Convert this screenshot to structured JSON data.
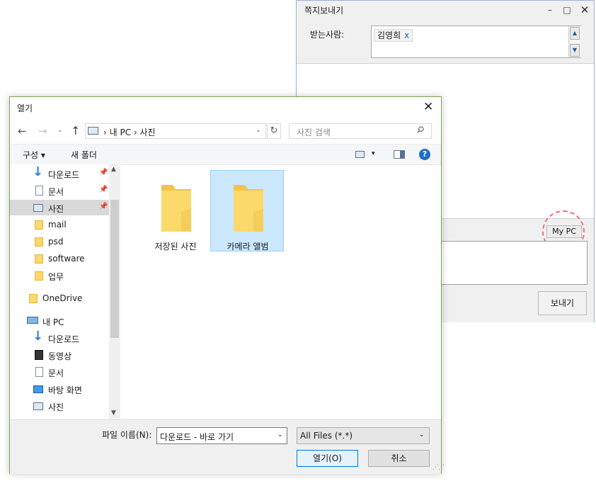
{
  "message_window": {
    "title": "쪽지보내기",
    "controls": {
      "minimize": "–",
      "maximize": "□",
      "close": "✕"
    },
    "recipient_label": "받는사람:",
    "recipient_chip": "김영희",
    "recipient_chip_remove": "x",
    "scroll_up": "▲",
    "scroll_down": "▼",
    "mypc_button": "My PC",
    "send_button": "보내기",
    "highlight_color": "#e8737b"
  },
  "open_dialog": {
    "title": "열기",
    "close": "✕",
    "nav": {
      "back": "←",
      "forward": "→",
      "recent": "⌄",
      "up": "↑",
      "refresh": "↻"
    },
    "address_path": "›  내 PC  ›  사진",
    "search_placeholder": "사진 검색",
    "toolbar": {
      "organize": "구성 ▾",
      "new_folder": "새 폴더",
      "view_dropdown": "▾",
      "help": "?"
    },
    "nav_pane": [
      {
        "label": "다운로드",
        "icon": "download-icon",
        "pinned": true
      },
      {
        "label": "문서",
        "icon": "document-icon",
        "pinned": true
      },
      {
        "label": "사진",
        "icon": "pictures-icon",
        "pinned": true,
        "selected": true
      },
      {
        "label": "mail",
        "icon": "folder-icon"
      },
      {
        "label": "psd",
        "icon": "folder-icon"
      },
      {
        "label": "software",
        "icon": "folder-icon"
      },
      {
        "label": "업무",
        "icon": "folder-icon"
      },
      {
        "label": "OneDrive",
        "icon": "folder-icon"
      },
      {
        "label": "내 PC",
        "icon": "computer-icon"
      },
      {
        "label": "다운로드",
        "icon": "download-icon"
      },
      {
        "label": "동영상",
        "icon": "video-icon"
      },
      {
        "label": "문서",
        "icon": "document-icon"
      },
      {
        "label": "바탕 화면",
        "icon": "desktop-icon"
      },
      {
        "label": "사진",
        "icon": "pictures-icon"
      }
    ],
    "pin_glyph": "📌",
    "files": [
      {
        "label": "저장된 사진",
        "selected": false
      },
      {
        "label": "카메라 앨범",
        "selected": true
      }
    ],
    "filename_label": "파일 이름(N):",
    "filename_value": "다운로드 - 바로 가기",
    "filter_value": "All Files (*.*)",
    "open_button": "열기(O)",
    "cancel_button": "취소",
    "dropdown_glyph": "⌄",
    "accent_color": "#0078d7"
  }
}
